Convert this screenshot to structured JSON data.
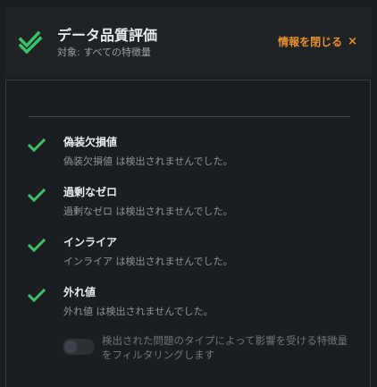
{
  "header": {
    "title": "データ品質評価",
    "subtitle": "対象: すべての特徴量",
    "close_label": "情報を閉じる",
    "close_icon": "×",
    "icon": "double-check-icon"
  },
  "colors": {
    "check_green": "#3cc26a",
    "accent_orange": "#e8912b"
  },
  "checks": [
    {
      "title": "偽装欠損値",
      "description": "偽装欠損値 は検出されませんでした。",
      "icon": "check-icon"
    },
    {
      "title": "過剰なゼロ",
      "description": "過剰なゼロ は検出されませんでした。",
      "icon": "check-icon"
    },
    {
      "title": "インライア",
      "description": "インライア は検出されませんでした。",
      "icon": "check-icon"
    },
    {
      "title": "外れ値",
      "description": "外れ値 は検出されませんでした。",
      "icon": "check-icon"
    }
  ],
  "filter": {
    "label": "検出された問題のタイプによって影響を受ける特徴量をフィルタリングします",
    "enabled": false
  }
}
